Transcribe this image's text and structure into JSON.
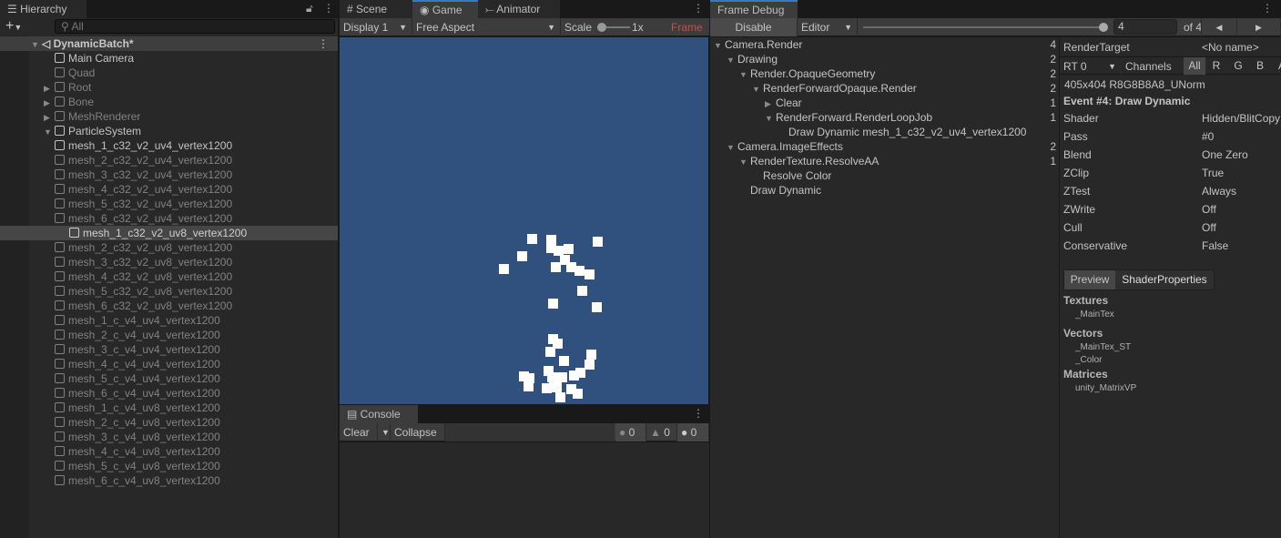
{
  "hierarchy": {
    "tab": "Hierarchy",
    "search_placeholder": "All",
    "scene": "DynamicBatch*",
    "items": [
      {
        "label": "Main Camera",
        "active": true,
        "expand": ""
      },
      {
        "label": "Quad",
        "active": false,
        "expand": ""
      },
      {
        "label": "Root",
        "active": false,
        "expand": "▶"
      },
      {
        "label": "Bone",
        "active": false,
        "expand": "▶"
      },
      {
        "label": "MeshRenderer",
        "active": false,
        "expand": "▶"
      },
      {
        "label": "ParticleSystem",
        "active": true,
        "expand": "▼"
      }
    ],
    "children": [
      "mesh_1_c32_v2_uv4_vertex1200",
      "mesh_2_c32_v2_uv4_vertex1200",
      "mesh_3_c32_v2_uv4_vertex1200",
      "mesh_4_c32_v2_uv4_vertex1200",
      "mesh_5_c32_v2_uv4_vertex1200",
      "mesh_6_c32_v2_uv4_vertex1200",
      "mesh_1_c32_v2_uv8_vertex1200",
      "mesh_2_c32_v2_uv8_vertex1200",
      "mesh_3_c32_v2_uv8_vertex1200",
      "mesh_4_c32_v2_uv8_vertex1200",
      "mesh_5_c32_v2_uv8_vertex1200",
      "mesh_6_c32_v2_uv8_vertex1200",
      "mesh_1_c_v4_uv4_vertex1200",
      "mesh_2_c_v4_uv4_vertex1200",
      "mesh_3_c_v4_uv4_vertex1200",
      "mesh_4_c_v4_uv4_vertex1200",
      "mesh_5_c_v4_uv4_vertex1200",
      "mesh_6_c_v4_uv4_vertex1200",
      "mesh_1_c_v4_uv8_vertex1200",
      "mesh_2_c_v4_uv8_vertex1200",
      "mesh_3_c_v4_uv8_vertex1200",
      "mesh_4_c_v4_uv8_vertex1200",
      "mesh_5_c_v4_uv8_vertex1200",
      "mesh_6_c_v4_uv8_vertex1200"
    ],
    "active_child": 0,
    "selected_child": 6
  },
  "game": {
    "tabs": [
      "Scene",
      "Game",
      "Animator"
    ],
    "display": "Display 1",
    "aspect": "Free Aspect",
    "scale_label": "Scale",
    "scale_value": "1x",
    "frame_label": "Frame",
    "bg_color": "#30507e"
  },
  "console": {
    "tab": "Console",
    "clear": "Clear",
    "collapse": "Collapse",
    "info_count": "0",
    "warn_count": "0",
    "error_count": "0"
  },
  "frame_debug": {
    "tab": "Frame Debug",
    "disable": "Disable",
    "target": "Editor",
    "event_value": "4",
    "of_label": "of 4",
    "event_fraction": 1.0,
    "tree": [
      {
        "label": "Camera.Render",
        "depth": 0,
        "exp": "▼",
        "count": "4"
      },
      {
        "label": "Drawing",
        "depth": 1,
        "exp": "▼",
        "count": "2"
      },
      {
        "label": "Render.OpaqueGeometry",
        "depth": 2,
        "exp": "▼",
        "count": "2"
      },
      {
        "label": "RenderForwardOpaque.Render",
        "depth": 3,
        "exp": "▼",
        "count": "2"
      },
      {
        "label": "Clear",
        "depth": 4,
        "exp": "▶",
        "count": "1"
      },
      {
        "label": "RenderForward.RenderLoopJob",
        "depth": 4,
        "exp": "▼",
        "count": "1"
      },
      {
        "label": "Draw Dynamic mesh_1_c32_v2_uv4_vertex1200",
        "depth": 5,
        "exp": "",
        "count": ""
      },
      {
        "label": "Camera.ImageEffects",
        "depth": 1,
        "exp": "▼",
        "count": "2"
      },
      {
        "label": "RenderTexture.ResolveAA",
        "depth": 2,
        "exp": "▼",
        "count": "1"
      },
      {
        "label": "Resolve Color",
        "depth": 3,
        "exp": "",
        "count": ""
      },
      {
        "label": "Draw Dynamic",
        "depth": 2,
        "exp": "",
        "count": ""
      }
    ],
    "render_target_label": "RenderTarget",
    "render_target_value": "<No name>",
    "rt": "RT 0",
    "channels_label": "Channels",
    "channels": [
      "All",
      "R",
      "G",
      "B",
      "A"
    ],
    "format": "405x404 R8G8B8A8_UNorm",
    "event_title": "Event #4: Draw Dynamic",
    "props": [
      [
        "Shader",
        "Hidden/BlitCopy"
      ],
      [
        "Pass",
        "#0"
      ],
      [
        "Blend",
        "One Zero"
      ],
      [
        "ZClip",
        "True"
      ],
      [
        "ZTest",
        "Always"
      ],
      [
        "ZWrite",
        "Off"
      ],
      [
        "Cull",
        "Off"
      ],
      [
        "Conservative",
        "False"
      ]
    ],
    "tabs": [
      "Preview",
      "ShaderProperties"
    ],
    "textures_h": "Textures",
    "textures": [
      "_MainTex"
    ],
    "vectors_h": "Vectors",
    "vectors": [
      "_MainTex_ST",
      "_Color"
    ],
    "matrices_h": "Matrices",
    "matrices": [
      "unity_MatrixVP"
    ]
  }
}
